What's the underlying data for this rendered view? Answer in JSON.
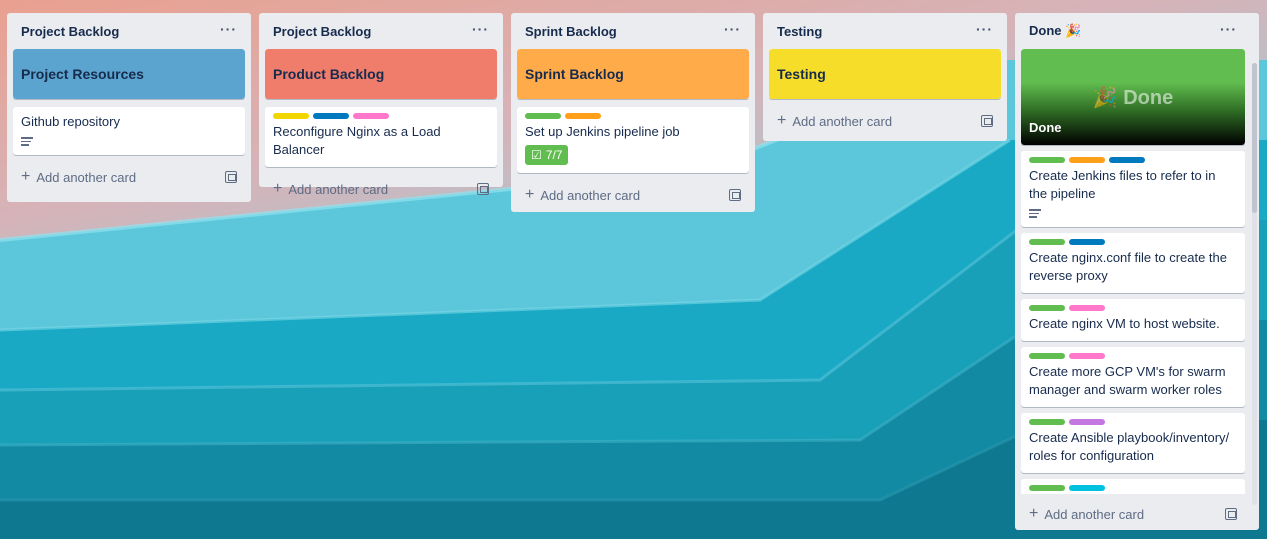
{
  "colors": {
    "green": "#61bd4f",
    "yellow": "#f2d600",
    "orange": "#ff9f1a",
    "red": "#eb5a46",
    "blue": "#0079bf",
    "pink": "#ff78cb",
    "purple": "#c377e0",
    "sky": "#00c2e0"
  },
  "add_card_label": "Add another card",
  "lists": [
    {
      "title": "Project Backlog",
      "menu": "···",
      "cover_title": "Project Resources",
      "cover_color": "#5ba4cf",
      "cards": [
        {
          "title": "Github repository",
          "labels": [],
          "has_description": true
        }
      ]
    },
    {
      "title": "Project Backlog",
      "menu": "···",
      "cover_title": "Product Backlog",
      "cover_color": "#f07c6b",
      "cards": [
        {
          "title": "Reconfigure Nginx as a Load Balancer",
          "labels": [
            "yellow",
            "blue",
            "pink"
          ]
        }
      ]
    },
    {
      "title": "Sprint Backlog",
      "menu": "···",
      "cover_title": "Sprint Backlog",
      "cover_color": "#ffab4a",
      "cards": [
        {
          "title": "Set up Jenkins pipeline job",
          "labels": [
            "green",
            "orange"
          ],
          "checklist": "7/7"
        }
      ]
    },
    {
      "title": "Testing",
      "menu": "···",
      "cover_title": "Testing",
      "cover_color": "#f5dd29",
      "cards": []
    },
    {
      "title": "Done 🎉",
      "menu": "···",
      "cover_title": "Done",
      "cover_art_text": "🎉 Done",
      "cards": [
        {
          "title": "Create Jenkins files to refer to in the pipeline",
          "labels": [
            "green",
            "orange",
            "blue"
          ],
          "has_description": true
        },
        {
          "title": "Create nginx.conf file to create the reverse proxy",
          "labels": [
            "green",
            "blue"
          ]
        },
        {
          "title": "Create nginx VM to host website.",
          "labels": [
            "green",
            "pink"
          ]
        },
        {
          "title": "Create more GCP VM's for swarm manager and swarm worker roles",
          "labels": [
            "green",
            "pink"
          ]
        },
        {
          "title": "Create Ansible playbook/inventory/ roles for configuration",
          "labels": [
            "green",
            "purple"
          ]
        },
        {
          "title": "",
          "labels": [
            "green",
            "sky"
          ]
        }
      ]
    }
  ]
}
